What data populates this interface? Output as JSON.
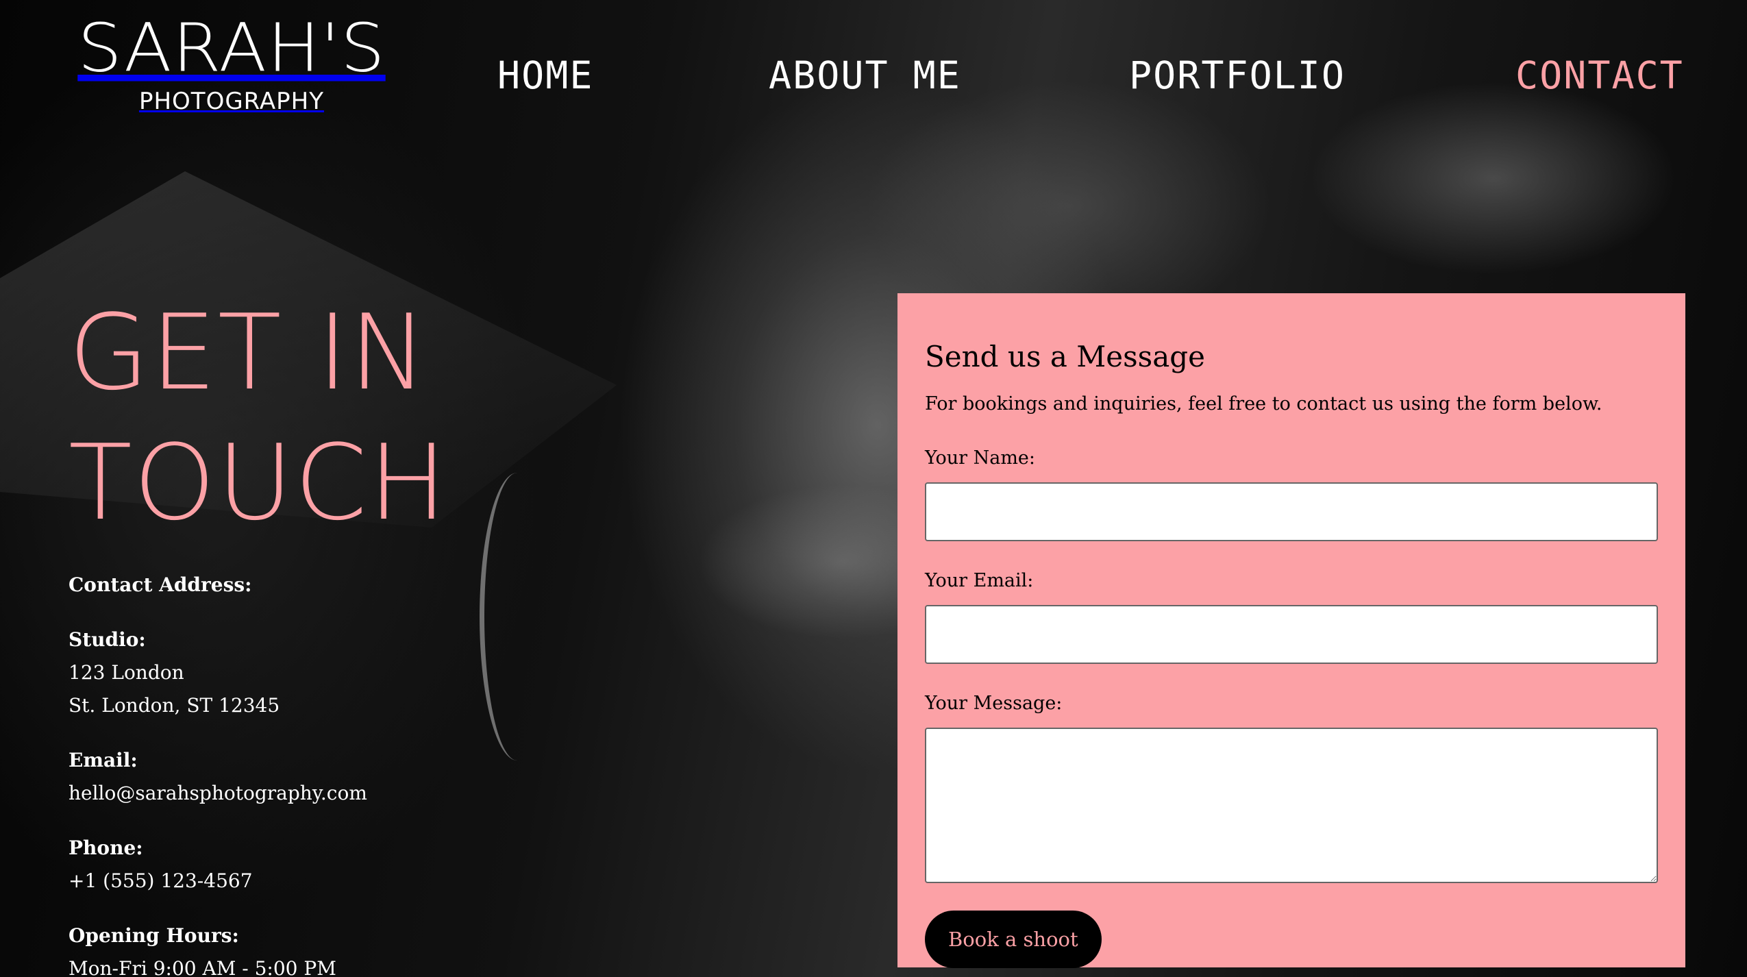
{
  "brand": {
    "name": "SARAH'S",
    "tagline": "PHOTOGRAPHY"
  },
  "nav": {
    "items": [
      {
        "label": "HOME",
        "active": false
      },
      {
        "label": "ABOUT ME",
        "active": false
      },
      {
        "label": "PORTFOLIO",
        "active": false
      },
      {
        "label": "CONTACT",
        "active": true
      }
    ]
  },
  "colors": {
    "accent": "#fca1a6",
    "background": "#000000",
    "button_bg": "#000000"
  },
  "headline": {
    "line1": "GET IN",
    "line2": "TOUCH"
  },
  "contact": {
    "address_label": "Contact Address:",
    "studio_label": "Studio:",
    "studio_line1": "123 London",
    "studio_line2": "St. London, ST 12345",
    "email_label": "Email:",
    "email_value": "hello@sarahsphotography.com",
    "phone_label": "Phone:",
    "phone_value": "+1 (555) 123-4567",
    "hours_label": "Opening Hours:",
    "hours_value": "Mon-Fri 9:00 AM - 5:00 PM"
  },
  "form": {
    "title": "Send us a Message",
    "subtitle": "For bookings and inquiries, feel free to contact us using the form below.",
    "name_label": "Your Name:",
    "name_value": "",
    "email_label": "Your Email:",
    "email_value": "",
    "message_label": "Your Message:",
    "message_value": "",
    "submit_label": "Book a shoot"
  }
}
